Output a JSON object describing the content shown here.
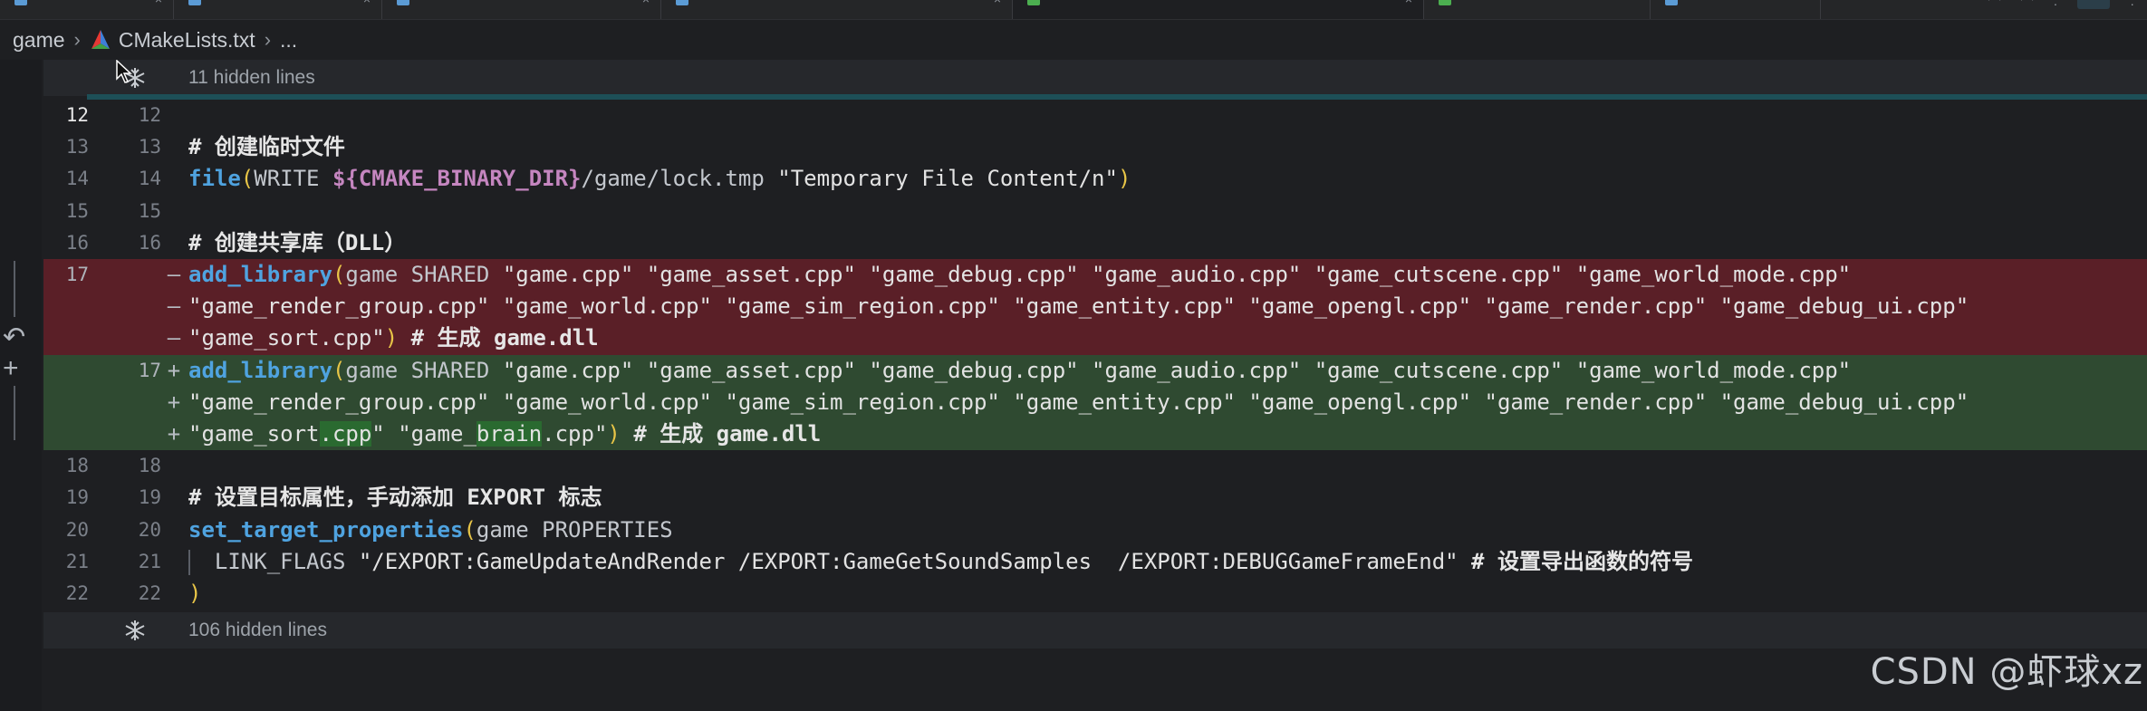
{
  "breadcrumb": {
    "folder": "game",
    "file": "CMakeLists.txt",
    "more": "..."
  },
  "hidden_top": {
    "label": "11 hidden lines"
  },
  "hidden_bottom": {
    "label": "106 hidden lines"
  },
  "lines": [
    {
      "old": "12",
      "new": "12",
      "kind": "ctx",
      "marker": "",
      "text": ""
    },
    {
      "old": "13",
      "new": "13",
      "kind": "ctx",
      "marker": "",
      "text": "# 创建临时文件"
    },
    {
      "old": "14",
      "new": "14",
      "kind": "ctx",
      "marker": "",
      "text": "file(WRITE ${CMAKE_BINARY_DIR}/game/lock.tmp \"Temporary File Content/n\")"
    },
    {
      "old": "15",
      "new": "15",
      "kind": "ctx",
      "marker": "",
      "text": ""
    },
    {
      "old": "16",
      "new": "16",
      "kind": "ctx",
      "marker": "",
      "text": "# 创建共享库（DLL）"
    },
    {
      "old": "17",
      "new": "",
      "kind": "del",
      "marker": "—",
      "text": "add_library(game SHARED \"game.cpp\" \"game_asset.cpp\" \"game_debug.cpp\" \"game_audio.cpp\" \"game_cutscene.cpp\" \"game_world_mode.cpp\""
    },
    {
      "old": "",
      "new": "",
      "kind": "del",
      "marker": "—",
      "text": "\"game_render_group.cpp\" \"game_world.cpp\" \"game_sim_region.cpp\" \"game_entity.cpp\" \"game_opengl.cpp\" \"game_render.cpp\" \"game_debug_ui.cpp\""
    },
    {
      "old": "",
      "new": "",
      "kind": "del",
      "marker": "—",
      "text": "\"game_sort.cpp\") # 生成 game.dll"
    },
    {
      "old": "",
      "new": "17",
      "kind": "add",
      "marker": "+",
      "text": "add_library(game SHARED \"game.cpp\" \"game_asset.cpp\" \"game_debug.cpp\" \"game_audio.cpp\" \"game_cutscene.cpp\" \"game_world_mode.cpp\""
    },
    {
      "old": "",
      "new": "",
      "kind": "add",
      "marker": "+",
      "text": "\"game_render_group.cpp\" \"game_world.cpp\" \"game_sim_region.cpp\" \"game_entity.cpp\" \"game_opengl.cpp\" \"game_render.cpp\" \"game_debug_ui.cpp\""
    },
    {
      "old": "",
      "new": "",
      "kind": "add",
      "marker": "+",
      "text": "\"game_sort.cpp\" \"game_brain.cpp\") # 生成 game.dll"
    },
    {
      "old": "18",
      "new": "18",
      "kind": "ctx",
      "marker": "",
      "text": ""
    },
    {
      "old": "19",
      "new": "19",
      "kind": "ctx",
      "marker": "",
      "text": "# 设置目标属性，手动添加 EXPORT 标志"
    },
    {
      "old": "20",
      "new": "20",
      "kind": "ctx",
      "marker": "",
      "text": "set_target_properties(game PROPERTIES"
    },
    {
      "old": "21",
      "new": "21",
      "kind": "ctx",
      "marker": "",
      "text": "  LINK_FLAGS \"/EXPORT:GameUpdateAndRender /EXPORT:GameGetSoundSamples  /EXPORT:DEBUGGameFrameEnd\" # 设置导出函数的符号"
    },
    {
      "old": "22",
      "new": "22",
      "kind": "ctx",
      "marker": "",
      "text": ")"
    }
  ],
  "watermark": "CSDN @虾球xz",
  "colors": {
    "deleted_bg": "#5a1f27",
    "added_bg": "#2f4a31",
    "keyword": "#4fa3e0",
    "paren": "#e8c547"
  }
}
